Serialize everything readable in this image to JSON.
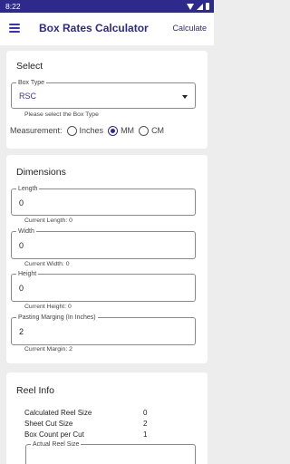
{
  "status": {
    "time": "8:22"
  },
  "app": {
    "title": "Box Rates Calculator",
    "calculate_label": "Calculate"
  },
  "select_card": {
    "title": "Select",
    "box_type": {
      "label": "Box Type",
      "value": "RSC",
      "helper": "Please select the Box Type"
    },
    "measurement": {
      "label": "Measurement:",
      "options": [
        {
          "label": "Inches",
          "checked": false
        },
        {
          "label": "MM",
          "checked": true
        },
        {
          "label": "CM",
          "checked": false
        }
      ]
    }
  },
  "dimensions_card": {
    "title": "Dimensions",
    "fields": [
      {
        "label": "Length",
        "value": "0",
        "helper": "Current Length: 0"
      },
      {
        "label": "Width",
        "value": "0",
        "helper": "Current Width: 0"
      },
      {
        "label": "Height",
        "value": "0",
        "helper": "Current Height: 0"
      },
      {
        "label": "Pasting Marging (In Inches)",
        "value": "2",
        "helper": "Current Margin: 2"
      }
    ]
  },
  "reel_card": {
    "title": "Reel Info",
    "rows": [
      {
        "label": "Calculated Reel Size",
        "value": "0"
      },
      {
        "label": "Sheet Cut Size",
        "value": "2"
      },
      {
        "label": "Box Count per Cut",
        "value": "1"
      }
    ],
    "actual_reel_label": "Actual Reel Size"
  },
  "colors": {
    "primary": "#2e2a8c",
    "background": "#ededed",
    "card": "#ffffff"
  }
}
